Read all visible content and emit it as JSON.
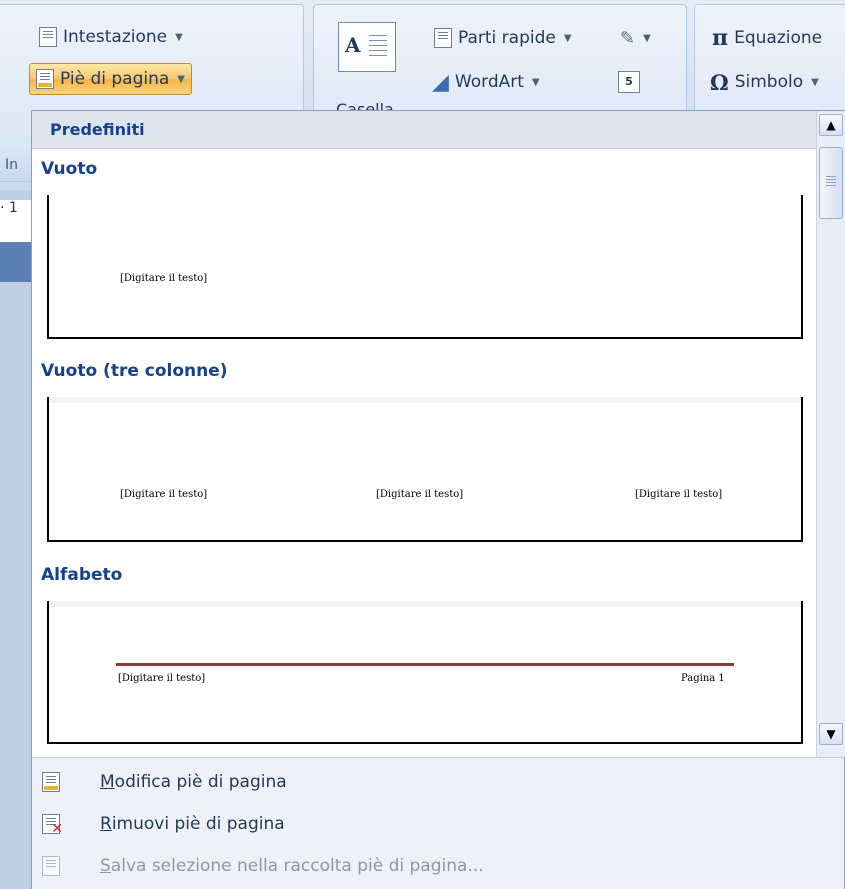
{
  "ribbon": {
    "header_button": "Intestazione",
    "footer_button": "Piè di pagina",
    "textbox_label": "Casella",
    "quickparts_button": "Parti rapide",
    "wordart_button": "WordArt",
    "equation_button": "Equazione",
    "symbol_button": "Simbolo",
    "group_label_fragment": "In",
    "ruler_number": "· 1"
  },
  "gallery": {
    "header": "Predefiniti",
    "sections": [
      {
        "title": "Vuoto",
        "placeholders": [
          "[Digitare il testo]"
        ]
      },
      {
        "title": "Vuoto (tre colonne)",
        "placeholders": [
          "[Digitare il testo]",
          "[Digitare il testo]",
          "[Digitare il testo]"
        ]
      },
      {
        "title": "Alfabeto",
        "placeholders": [
          "[Digitare il testo]"
        ],
        "page_label": "Pagina 1",
        "line_color": "#8b3a3a"
      }
    ]
  },
  "commands": {
    "edit_prefix": "M",
    "edit_rest": "odifica piè di pagina",
    "remove_prefix": "R",
    "remove_rest": "imuovi piè di pagina",
    "save_prefix": "S",
    "save_rest": "alva selezione nella raccolta piè di pagina..."
  },
  "scrollbar": {
    "up_arrow": "▲",
    "down_arrow": "▼"
  },
  "colors": {
    "accent_text": "#15428b",
    "pressed_button": "#f8c66b"
  }
}
